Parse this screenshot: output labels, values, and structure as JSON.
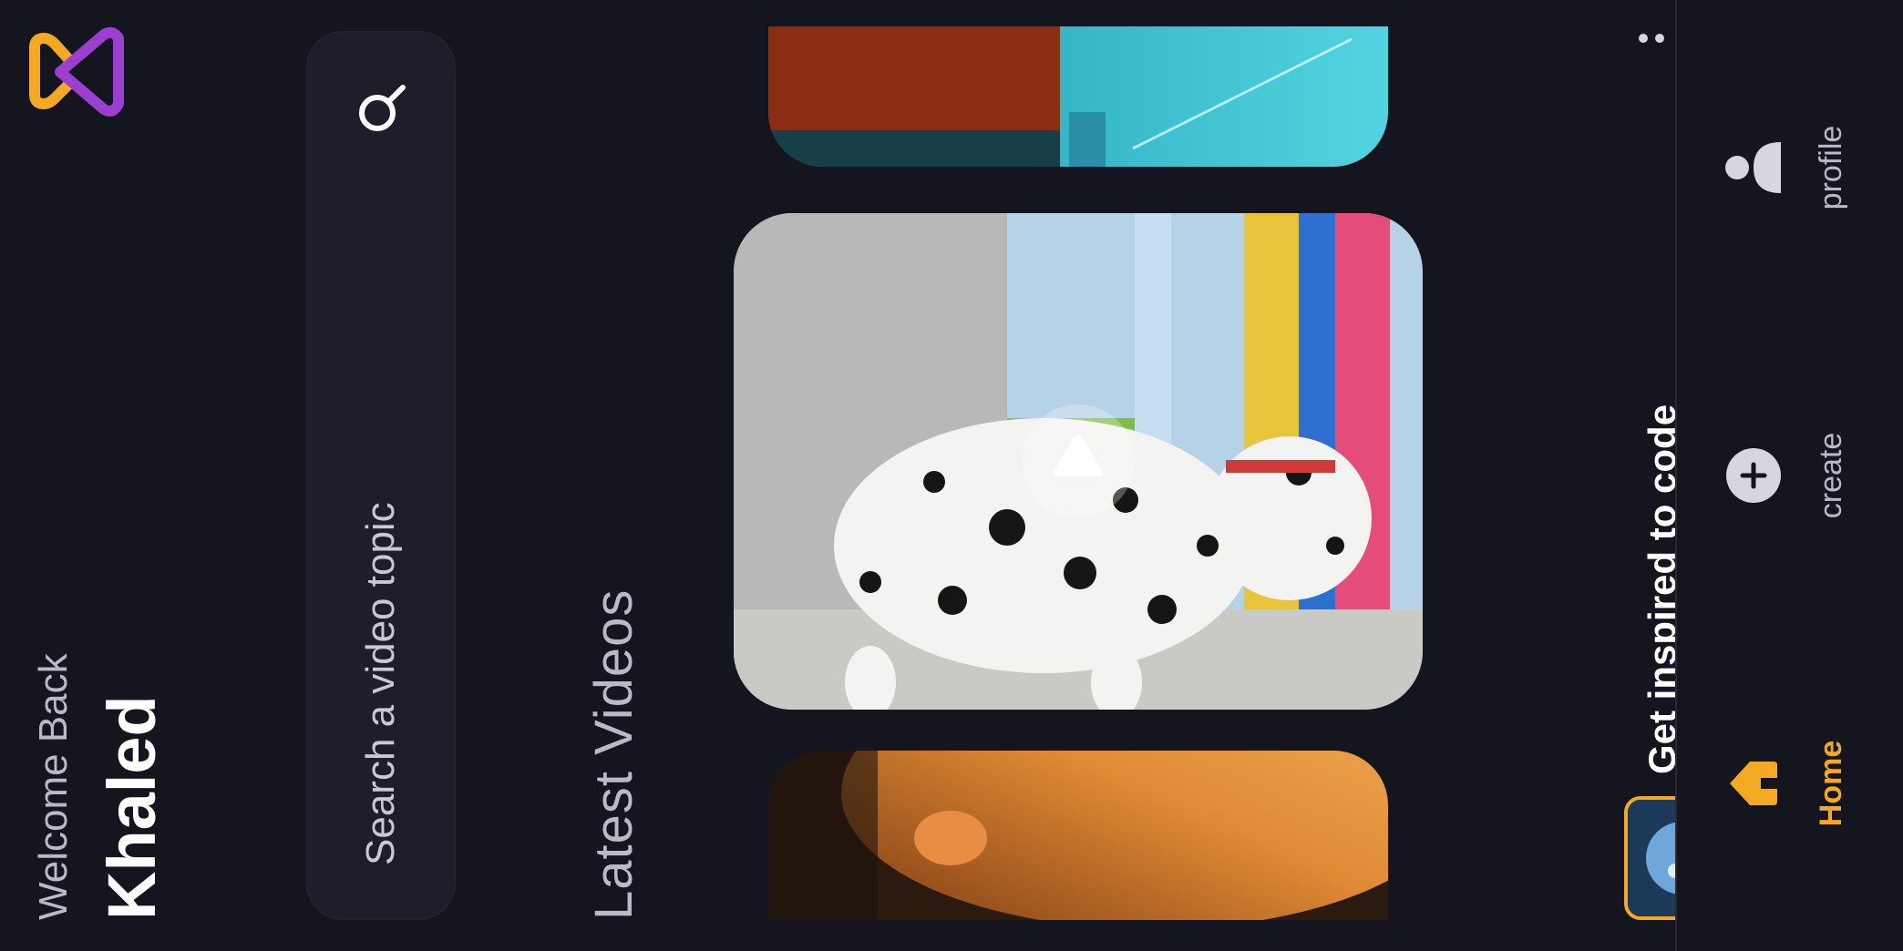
{
  "header": {
    "welcome": "Welcome Back",
    "username": "Khaled"
  },
  "search": {
    "placeholder": "Search a video topic"
  },
  "videos": {
    "section_title": "Latest Videos",
    "items": [
      {
        "name": "portrait-closeup"
      },
      {
        "name": "dalmatian-dog"
      },
      {
        "name": "teal-cyberpunk"
      }
    ]
  },
  "inspire": {
    "title": "Get inspired to code"
  },
  "nav": {
    "items": [
      {
        "label": "Home",
        "icon": "home-icon",
        "active": true
      },
      {
        "label": "create",
        "icon": "plus-circle-icon",
        "active": false
      },
      {
        "label": "profile",
        "icon": "profile-icon",
        "active": false
      }
    ]
  },
  "colors": {
    "background": "#15151f",
    "surface": "#1e1e2b",
    "accent": "#f4a922",
    "brand_purple": "#9b3fd1",
    "text": "#ffffff",
    "muted": "#b9b9c7"
  }
}
